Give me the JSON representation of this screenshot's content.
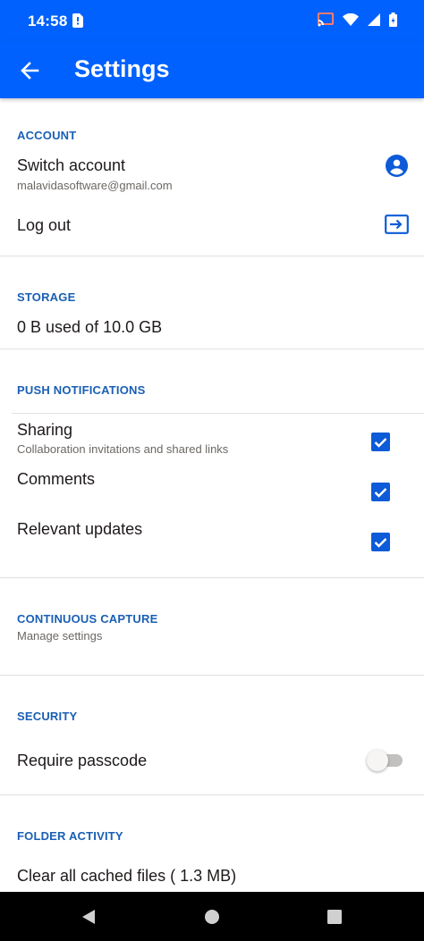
{
  "status_bar": {
    "time": "14:58",
    "icons": [
      "sim-card-icon",
      "cast-icon",
      "wifi-icon",
      "signal-icon",
      "battery-icon"
    ]
  },
  "app_bar": {
    "title": "Settings",
    "back_icon": "arrow-left-icon"
  },
  "sections": {
    "account": {
      "header": "ACCOUNT",
      "switch_account": {
        "title": "Switch account",
        "subtitle": "malavidasoftware@gmail.com",
        "icon": "account-circle-icon"
      },
      "log_out": {
        "title": "Log out",
        "icon": "logout-icon"
      }
    },
    "storage": {
      "header": "STORAGE",
      "usage": "0 B used of 10.0 GB"
    },
    "push_notifications": {
      "header": "PUSH NOTIFICATIONS",
      "items": [
        {
          "title": "Sharing",
          "subtitle": "Collaboration invitations and shared links",
          "checked": true
        },
        {
          "title": "Comments",
          "checked": true
        },
        {
          "title": "Relevant updates",
          "checked": true
        }
      ]
    },
    "continuous_capture": {
      "header": "CONTINUOUS CAPTURE",
      "subtitle": "Manage settings"
    },
    "security": {
      "header": "SECURITY",
      "require_passcode": {
        "title": "Require passcode",
        "enabled": false
      }
    },
    "folder_activity": {
      "header": "FOLDER ACTIVITY",
      "clear_cache": "Clear all cached files ( 1.3 MB)"
    }
  },
  "nav_bar": {
    "icons": [
      "back-triangle-icon",
      "home-circle-icon",
      "recents-square-icon"
    ]
  },
  "colors": {
    "primary": "#0061fe",
    "section_header": "#1a5fb4",
    "checkbox": "#0d5bd8",
    "text": "#1e1919",
    "subtext": "#6b6763"
  }
}
